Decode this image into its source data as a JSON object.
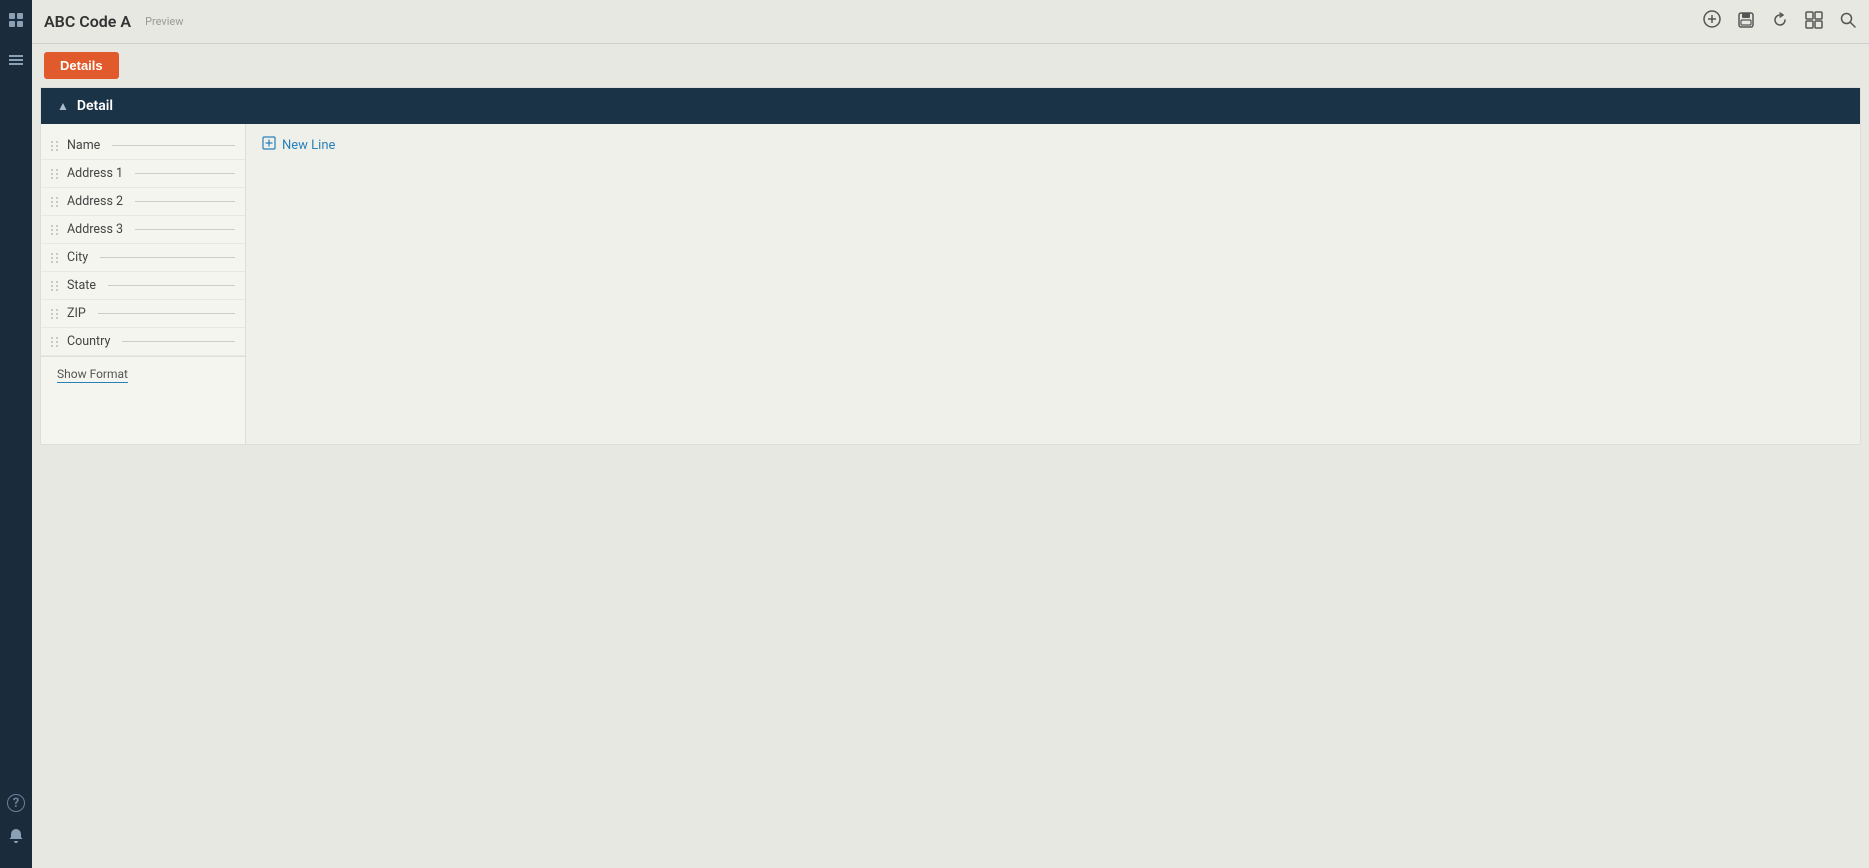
{
  "app": {
    "title": "ABC Code A",
    "preview_label": "Preview"
  },
  "toolbar": {
    "details_button": "Details"
  },
  "topbar_actions": {
    "add_icon": "⊕",
    "save_icon": "💾",
    "refresh_icon": "↺",
    "layout_icon": "▦",
    "search_icon": "🔍"
  },
  "section": {
    "title": "Detail",
    "new_line_label": "New Line"
  },
  "fields": [
    {
      "label": "Name"
    },
    {
      "label": "Address 1"
    },
    {
      "label": "Address 2"
    },
    {
      "label": "Address 3"
    },
    {
      "label": "City"
    },
    {
      "label": "State"
    },
    {
      "label": "ZIP"
    },
    {
      "label": "Country"
    }
  ],
  "footer": {
    "show_format_label": "Show Format"
  },
  "sidebar": {
    "icons": [
      "⊞",
      "☰"
    ],
    "bottom_icons": [
      "?",
      "🔔"
    ]
  }
}
